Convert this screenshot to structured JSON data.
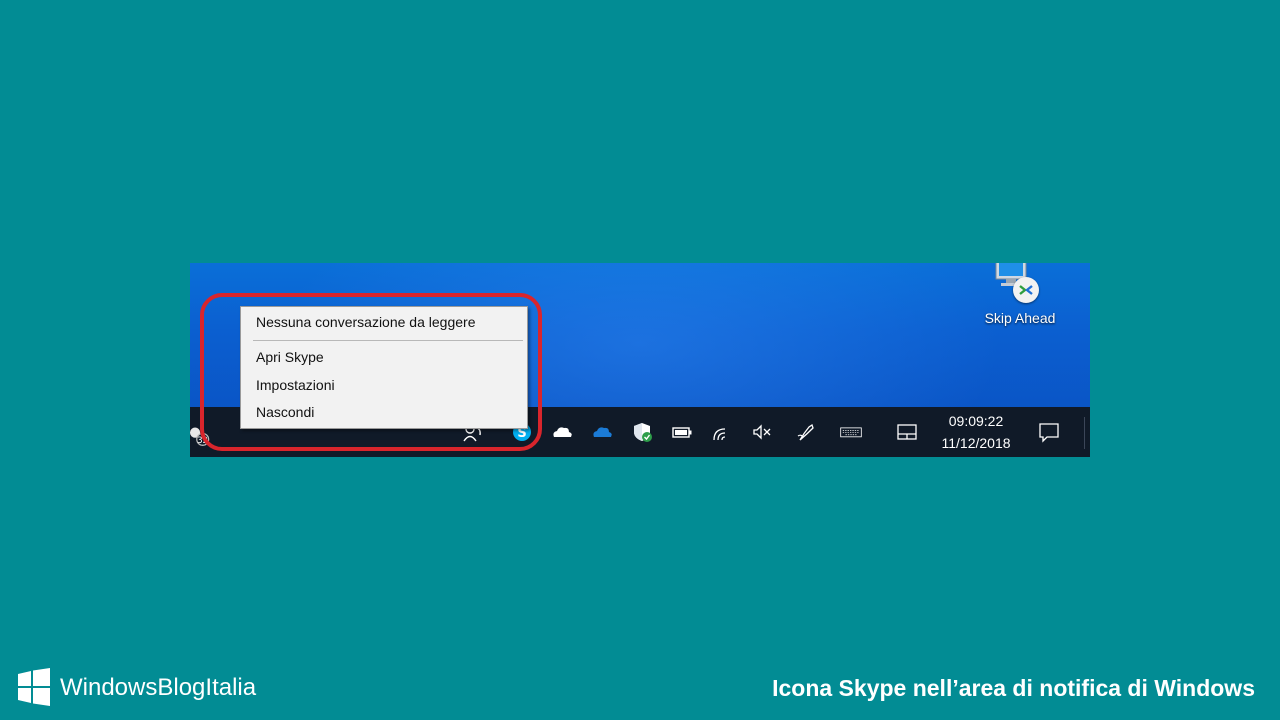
{
  "desktop": {
    "icon_label": "Skip Ahead",
    "icon_name": "remote-desktop-icon"
  },
  "context_menu": {
    "header": "Nessuna conversazione da leggere",
    "items": [
      "Apri Skype",
      "Impostazioni",
      "Nascondi"
    ]
  },
  "taskbar": {
    "time": "09:09:22",
    "date": "11/12/2018",
    "tray_icons": [
      "skype-icon",
      "onedrive-icon",
      "onedrive-business-icon",
      "defender-shield-icon",
      "battery-icon",
      "wifi-icon",
      "volume-muted-icon",
      "pen-workspace-icon",
      "touch-keyboard-icon",
      "touchpad-icon",
      "action-center-icon"
    ]
  },
  "footer": {
    "brand": "WindowsBlogItalia",
    "caption": "Icona Skype nell’area di notifica di Windows"
  },
  "colors": {
    "background": "#028c94",
    "highlight": "#d9252c",
    "taskbar": "#101a28",
    "skype": "#00aff0",
    "onedrive": "#1b7bd6"
  }
}
